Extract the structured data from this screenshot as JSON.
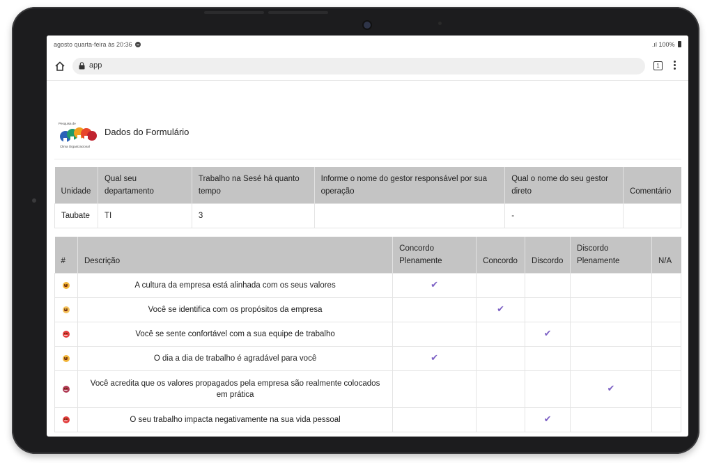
{
  "status": {
    "datetime": "agosto quarta-feira às 20:36",
    "signal_battery": "100%"
  },
  "browser": {
    "url": "app",
    "tab_count": "1"
  },
  "header": {
    "logo_top": "Pesquisa de",
    "logo_bottom": "Clima Organizacional",
    "title": "Dados do Formulário"
  },
  "form_table": {
    "headers": [
      "Unidade",
      "Qual seu departamento",
      "Trabalho na Sesé há quanto tempo",
      "Informe o nome do gestor responsável por sua operação",
      "Qual o nome do seu gestor direto",
      "Comentário"
    ],
    "row": [
      "Taubate",
      "TI",
      "3",
      "",
      "-",
      ""
    ]
  },
  "survey_table": {
    "headers": [
      "#",
      "Descrição",
      "Concordo Plenamente",
      "Concordo",
      "Discordo",
      "Discordo Plenamente",
      "N/A"
    ],
    "rows": [
      {
        "mood": "happy-face-icon",
        "description": "A cultura da empresa está alinhada com os seus valores",
        "answer": 0
      },
      {
        "mood": "smile-face-icon",
        "description": "Você se identifica com os propósitos da empresa",
        "answer": 1
      },
      {
        "mood": "angry-face-icon",
        "description": "Você se sente confortável com a sua equipe de trabalho",
        "answer": 2
      },
      {
        "mood": "happy-face-icon",
        "description": "O dia a dia de trabalho é agradável para você",
        "answer": 0
      },
      {
        "mood": "sad-face-icon",
        "description": "Você acredita que os valores propagados pela empresa são realmente colocados em prática",
        "answer": 3
      },
      {
        "mood": "angry-face-icon",
        "description": "O seu trabalho impacta negativamente na sua vida pessoal",
        "answer": 2
      }
    ],
    "check_glyph": "✔"
  },
  "colors": {
    "check": "#7b5fc4",
    "header_bg": "#c4c4c4"
  }
}
